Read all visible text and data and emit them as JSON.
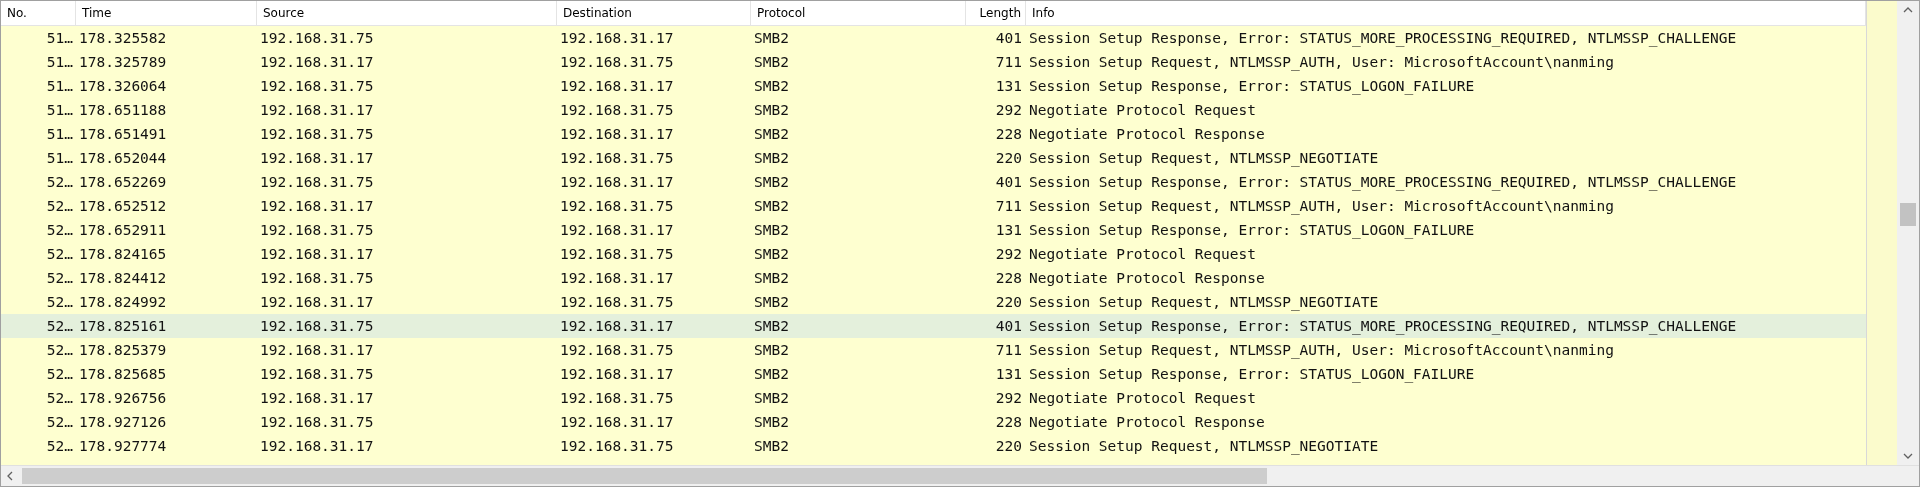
{
  "table": {
    "columns": [
      "No.",
      "Time",
      "Source",
      "Destination",
      "Protocol",
      "Length",
      "Info"
    ],
    "rows": [
      {
        "no": "51…",
        "time": "178.325582",
        "source": "192.168.31.75",
        "destination": "192.168.31.17",
        "protocol": "SMB2",
        "length": "401",
        "info": "Session Setup Response, Error: STATUS_MORE_PROCESSING_REQUIRED, NTLMSSP_CHALLENGE",
        "selected": false
      },
      {
        "no": "51…",
        "time": "178.325789",
        "source": "192.168.31.17",
        "destination": "192.168.31.75",
        "protocol": "SMB2",
        "length": "711",
        "info": "Session Setup Request, NTLMSSP_AUTH, User: MicrosoftAccount\\nanming",
        "selected": false
      },
      {
        "no": "51…",
        "time": "178.326064",
        "source": "192.168.31.75",
        "destination": "192.168.31.17",
        "protocol": "SMB2",
        "length": "131",
        "info": "Session Setup Response, Error: STATUS_LOGON_FAILURE",
        "selected": false
      },
      {
        "no": "51…",
        "time": "178.651188",
        "source": "192.168.31.17",
        "destination": "192.168.31.75",
        "protocol": "SMB2",
        "length": "292",
        "info": "Negotiate Protocol Request",
        "selected": false
      },
      {
        "no": "51…",
        "time": "178.651491",
        "source": "192.168.31.75",
        "destination": "192.168.31.17",
        "protocol": "SMB2",
        "length": "228",
        "info": "Negotiate Protocol Response",
        "selected": false
      },
      {
        "no": "51…",
        "time": "178.652044",
        "source": "192.168.31.17",
        "destination": "192.168.31.75",
        "protocol": "SMB2",
        "length": "220",
        "info": "Session Setup Request, NTLMSSP_NEGOTIATE",
        "selected": false
      },
      {
        "no": "52…",
        "time": "178.652269",
        "source": "192.168.31.75",
        "destination": "192.168.31.17",
        "protocol": "SMB2",
        "length": "401",
        "info": "Session Setup Response, Error: STATUS_MORE_PROCESSING_REQUIRED, NTLMSSP_CHALLENGE",
        "selected": false
      },
      {
        "no": "52…",
        "time": "178.652512",
        "source": "192.168.31.17",
        "destination": "192.168.31.75",
        "protocol": "SMB2",
        "length": "711",
        "info": "Session Setup Request, NTLMSSP_AUTH, User: MicrosoftAccount\\nanming",
        "selected": false
      },
      {
        "no": "52…",
        "time": "178.652911",
        "source": "192.168.31.75",
        "destination": "192.168.31.17",
        "protocol": "SMB2",
        "length": "131",
        "info": "Session Setup Response, Error: STATUS_LOGON_FAILURE",
        "selected": false
      },
      {
        "no": "52…",
        "time": "178.824165",
        "source": "192.168.31.17",
        "destination": "192.168.31.75",
        "protocol": "SMB2",
        "length": "292",
        "info": "Negotiate Protocol Request",
        "selected": false
      },
      {
        "no": "52…",
        "time": "178.824412",
        "source": "192.168.31.75",
        "destination": "192.168.31.17",
        "protocol": "SMB2",
        "length": "228",
        "info": "Negotiate Protocol Response",
        "selected": false
      },
      {
        "no": "52…",
        "time": "178.824992",
        "source": "192.168.31.17",
        "destination": "192.168.31.75",
        "protocol": "SMB2",
        "length": "220",
        "info": "Session Setup Request, NTLMSSP_NEGOTIATE",
        "selected": false
      },
      {
        "no": "52…",
        "time": "178.825161",
        "source": "192.168.31.75",
        "destination": "192.168.31.17",
        "protocol": "SMB2",
        "length": "401",
        "info": "Session Setup Response, Error: STATUS_MORE_PROCESSING_REQUIRED, NTLMSSP_CHALLENGE",
        "selected": true
      },
      {
        "no": "52…",
        "time": "178.825379",
        "source": "192.168.31.17",
        "destination": "192.168.31.75",
        "protocol": "SMB2",
        "length": "711",
        "info": "Session Setup Request, NTLMSSP_AUTH, User: MicrosoftAccount\\nanming",
        "selected": false
      },
      {
        "no": "52…",
        "time": "178.825685",
        "source": "192.168.31.75",
        "destination": "192.168.31.17",
        "protocol": "SMB2",
        "length": "131",
        "info": "Session Setup Response, Error: STATUS_LOGON_FAILURE",
        "selected": false
      },
      {
        "no": "52…",
        "time": "178.926756",
        "source": "192.168.31.17",
        "destination": "192.168.31.75",
        "protocol": "SMB2",
        "length": "292",
        "info": "Negotiate Protocol Request",
        "selected": false
      },
      {
        "no": "52…",
        "time": "178.927126",
        "source": "192.168.31.75",
        "destination": "192.168.31.17",
        "protocol": "SMB2",
        "length": "228",
        "info": "Negotiate Protocol Response",
        "selected": false
      },
      {
        "no": "52…",
        "time": "178.927774",
        "source": "192.168.31.17",
        "destination": "192.168.31.75",
        "protocol": "SMB2",
        "length": "220",
        "info": "Session Setup Request, NTLMSSP_NEGOTIATE",
        "selected": false
      }
    ]
  }
}
